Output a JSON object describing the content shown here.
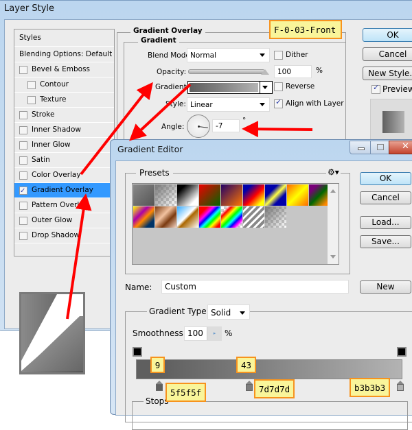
{
  "layer_style": {
    "title": "Layer Style",
    "styles_header": "Styles",
    "blending_options": "Blending Options: Default",
    "items": [
      {
        "label": "Bevel & Emboss",
        "checked": false,
        "sub": false
      },
      {
        "label": "Contour",
        "checked": false,
        "sub": true
      },
      {
        "label": "Texture",
        "checked": false,
        "sub": true
      },
      {
        "label": "Stroke",
        "checked": false,
        "sub": false
      },
      {
        "label": "Inner Shadow",
        "checked": false,
        "sub": false
      },
      {
        "label": "Inner Glow",
        "checked": false,
        "sub": false
      },
      {
        "label": "Satin",
        "checked": false,
        "sub": false
      },
      {
        "label": "Color Overlay",
        "checked": false,
        "sub": false
      },
      {
        "label": "Gradient Overlay",
        "checked": true,
        "sub": false,
        "selected": true
      },
      {
        "label": "Pattern Overlay",
        "checked": false,
        "sub": false
      },
      {
        "label": "Outer Glow",
        "checked": false,
        "sub": false
      },
      {
        "label": "Drop Shadow",
        "checked": false,
        "sub": false
      }
    ],
    "panel_title": "Gradient Overlay",
    "group_title": "Gradient",
    "blend_mode_label": "Blend Mode:",
    "blend_mode_value": "Normal",
    "dither_label": "Dither",
    "dither_checked": false,
    "opacity_label": "Opacity:",
    "opacity_value": "100",
    "opacity_unit": "%",
    "opacity_slider_fraction": 1.0,
    "gradient_label": "Gradient:",
    "reverse_label": "Reverse",
    "reverse_checked": false,
    "style_label": "Style:",
    "style_value": "Linear",
    "align_label": "Align with Layer",
    "align_checked": true,
    "angle_label": "Angle:",
    "angle_value": "-7",
    "angle_unit": "°",
    "ok": "OK",
    "cancel": "Cancel",
    "new_style": "New Style...",
    "preview_label": "Preview",
    "preview_checked": true
  },
  "annotation_tag": "F-0-03-Front",
  "gradient_editor": {
    "title": "Gradient Editor",
    "presets_label": "Presets",
    "ok": "OK",
    "cancel": "Cancel",
    "load": "Load...",
    "save": "Save...",
    "name_label": "Name:",
    "name_value": "Custom",
    "new_button": "New",
    "gradient_type_label": "Gradient Type:",
    "gradient_type_value": "Solid",
    "smoothness_label": "Smoothness:",
    "smoothness_value": "100",
    "smoothness_unit": "%",
    "stops_label": "Stops",
    "color_stops": [
      {
        "location_label": "9",
        "color": "#5f5f5f",
        "hex_label": "5f5f5f"
      },
      {
        "location_label": "43",
        "color": "#7d7d7d",
        "hex_label": "7d7d7d"
      },
      {
        "location_label": "",
        "color": "#b3b3b3",
        "hex_label": "b3b3b3"
      }
    ]
  },
  "colors": {
    "selected_item": "#3399ff",
    "annotation_arrow": "#ff0000",
    "tag_fill": "#f9f59a",
    "tag_border": "#f7931e"
  }
}
